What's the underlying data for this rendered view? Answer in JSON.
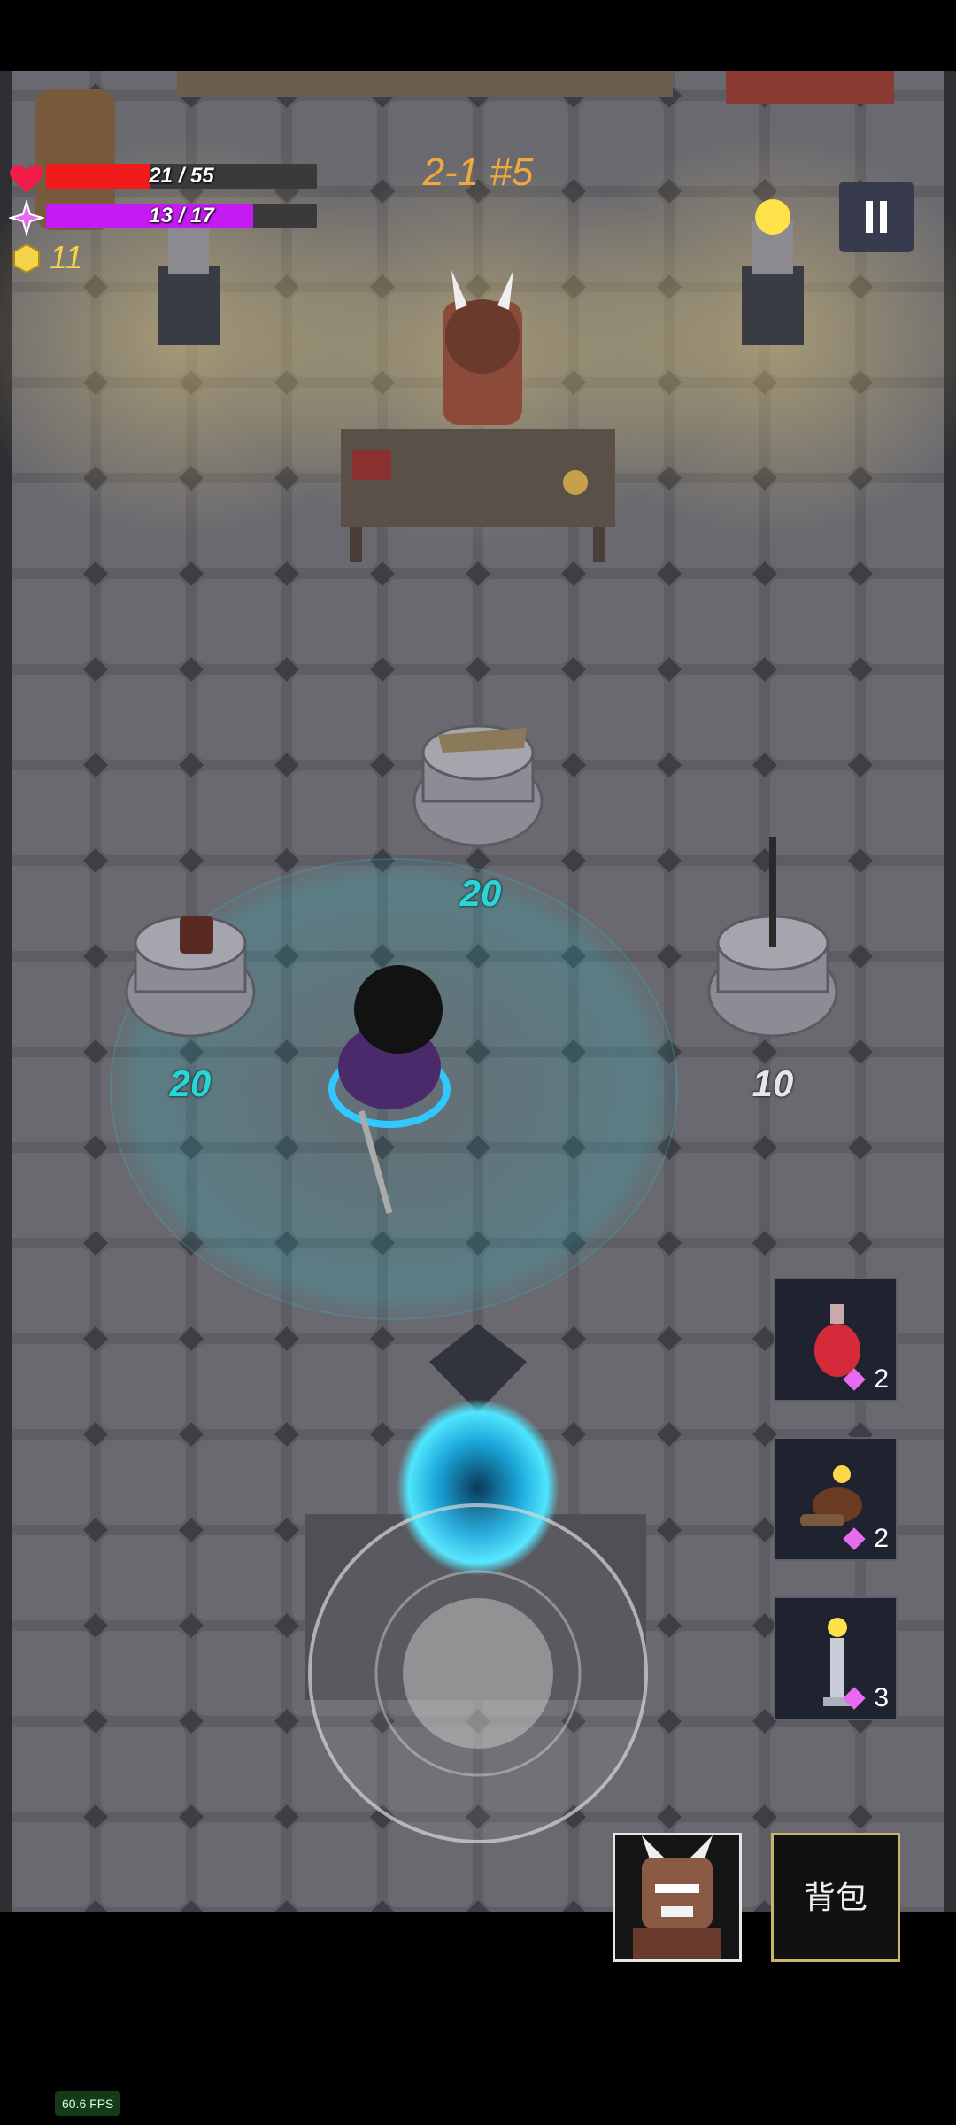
{
  "hud": {
    "hp_text": "21 / 55",
    "hp_ratio": 0.381,
    "mana_text": "13 / 17",
    "mana_ratio": 0.765,
    "gold": "11",
    "stage": "2-1 #5",
    "colors": {
      "hp": "#f21b1b",
      "mana": "#c51bf2",
      "gold": "#f5d34a",
      "stage": "#f0a93a"
    }
  },
  "shop_items": [
    {
      "name": "crossbow",
      "price": "20",
      "price_color": "#27d6d6"
    },
    {
      "name": "bucket-helmet",
      "price": "20",
      "price_color": "#27d6d6"
    },
    {
      "name": "spear",
      "price": "10",
      "price_color": "#e6e6e6"
    }
  ],
  "skill_slots": [
    {
      "icon": "red-potion-icon",
      "count": "2"
    },
    {
      "icon": "fire-cauldron-icon",
      "count": "2"
    },
    {
      "icon": "lamp-pillar-icon",
      "count": "3"
    }
  ],
  "buttons": {
    "pause_icon": "pause-icon",
    "backpack_label": "背包",
    "npc_portrait_icon": "merchant-portrait-icon"
  },
  "fps_text": "60.6 FPS"
}
